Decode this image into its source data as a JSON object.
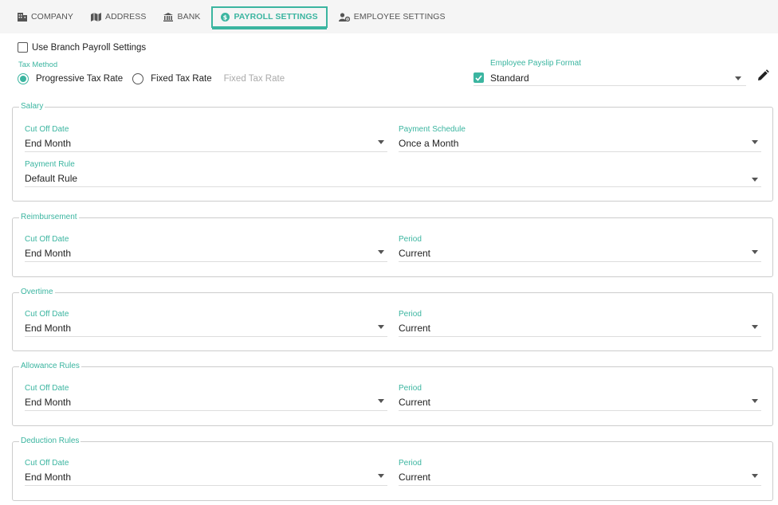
{
  "tabs": [
    {
      "label": "COMPANY",
      "icon": "building-icon",
      "active": false
    },
    {
      "label": "ADDRESS",
      "icon": "map-icon",
      "active": false
    },
    {
      "label": "BANK",
      "icon": "bank-icon",
      "active": false
    },
    {
      "label": "PAYROLL SETTINGS",
      "icon": "dollar-icon",
      "active": true
    },
    {
      "label": "EMPLOYEE SETTINGS",
      "icon": "user-gear-icon",
      "active": false
    }
  ],
  "use_branch": {
    "label": "Use Branch Payroll Settings",
    "checked": false
  },
  "tax_method": {
    "label": "Tax Method",
    "options": [
      "Progressive Tax Rate",
      "Fixed Tax Rate"
    ],
    "selected": "Progressive Tax Rate",
    "fixed_rate_placeholder": "Fixed Tax Rate"
  },
  "payslip": {
    "label": "Employee Payslip Format",
    "value": "Standard",
    "checked": true
  },
  "salary": {
    "title": "Salary",
    "cutoff_label": "Cut Off Date",
    "cutoff_value": "End Month",
    "schedule_label": "Payment Schedule",
    "schedule_value": "Once a Month",
    "rule_label": "Payment Rule",
    "rule_value": "Default Rule"
  },
  "reimbursement": {
    "title": "Reimbursement",
    "cutoff_label": "Cut Off Date",
    "cutoff_value": "End Month",
    "period_label": "Period",
    "period_value": "Current"
  },
  "overtime": {
    "title": "Overtime",
    "cutoff_label": "Cut Off Date",
    "cutoff_value": "End Month",
    "period_label": "Period",
    "period_value": "Current"
  },
  "allowance": {
    "title": "Allowance Rules",
    "cutoff_label": "Cut Off Date",
    "cutoff_value": "End Month",
    "period_label": "Period",
    "period_value": "Current"
  },
  "deduction": {
    "title": "Deduction Rules",
    "cutoff_label": "Cut Off Date",
    "cutoff_value": "End Month",
    "period_label": "Period",
    "period_value": "Current"
  },
  "colors": {
    "accent": "#3bb5a0",
    "border": "#cccccc",
    "tabbar": "#f5f5f5"
  }
}
